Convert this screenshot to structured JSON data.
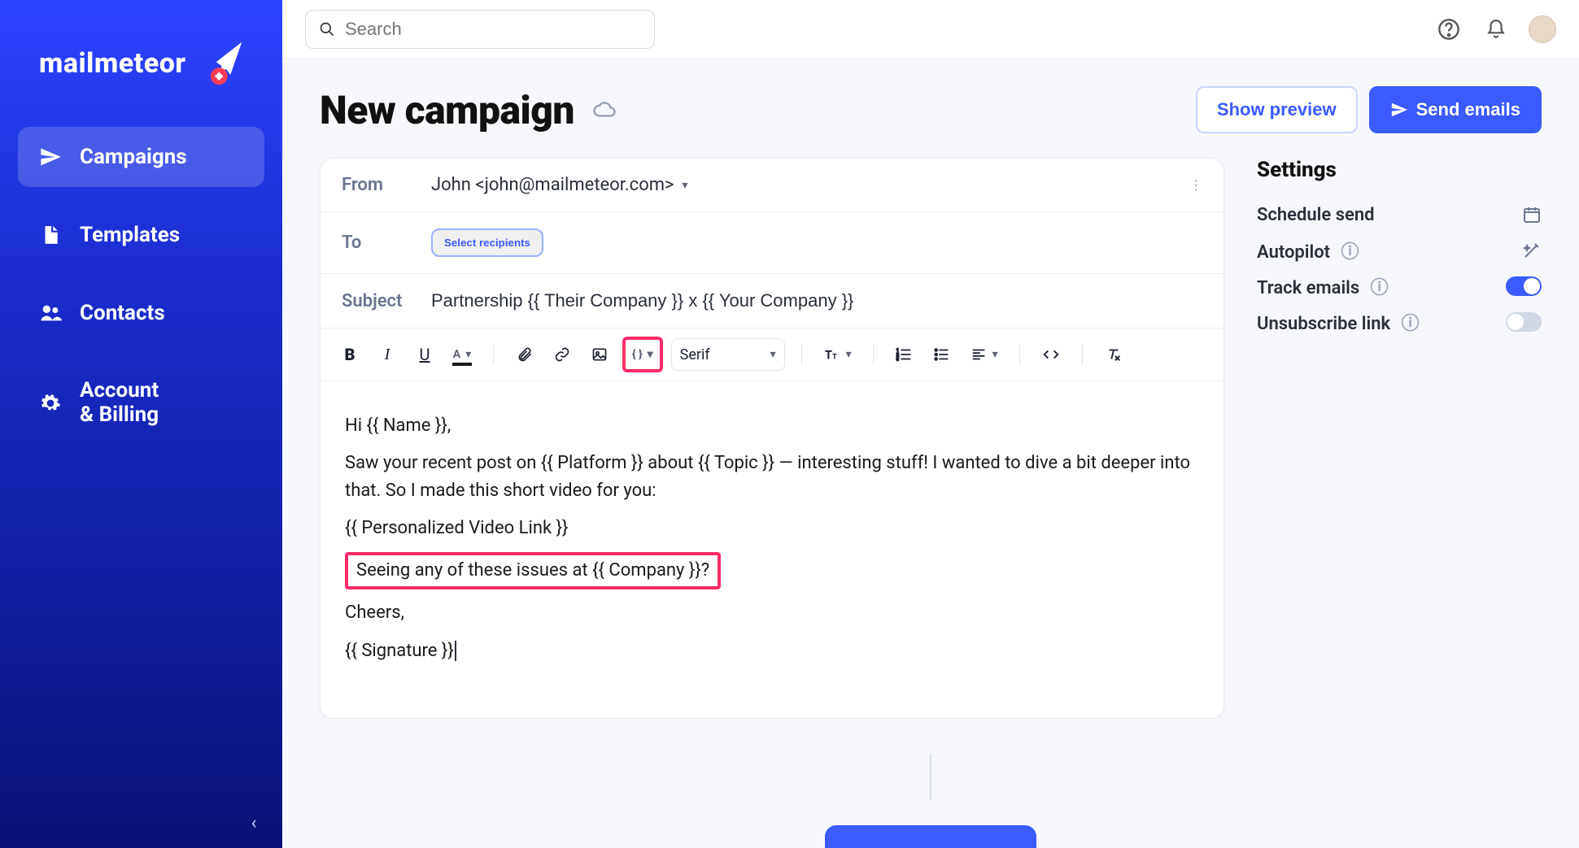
{
  "brand": {
    "name": "mailmeteor"
  },
  "nav": {
    "campaigns": "Campaigns",
    "templates": "Templates",
    "contacts": "Contacts",
    "account_line1": "Account",
    "account_line2": "& Billing"
  },
  "search": {
    "placeholder": "Search"
  },
  "page": {
    "title": "New campaign"
  },
  "actions": {
    "preview": "Show preview",
    "send": "Send emails"
  },
  "compose": {
    "from_label": "From",
    "from_value": "John <john@mailmeteor.com>",
    "to_label": "To",
    "select_recipients": "Select recipients",
    "subject_label": "Subject",
    "subject_value": "Partnership {{ Their Company }} x {{ Your Company }}",
    "font_family": "Serif",
    "body": {
      "p1": "Hi {{ Name }},",
      "p2": "Saw your recent post on {{ Platform }} about {{ Topic }} — interesting stuff! I wanted to dive a bit deeper into that. So I made this short video for you:",
      "p3": "{{ Personalized Video Link }}",
      "p4": "Seeing any of these issues at {{ Company }}?",
      "p5": "Cheers,",
      "p6": "{{ Signature }}"
    }
  },
  "settings": {
    "title": "Settings",
    "schedule": "Schedule send",
    "autopilot": "Autopilot",
    "track": "Track emails",
    "unsubscribe": "Unsubscribe link",
    "track_on": true,
    "unsubscribe_on": false
  },
  "glyphs": {
    "search": "🔍",
    "help": "?",
    "bell": "🔔",
    "more": "⋮",
    "caret": "▾",
    "chevron_left": "‹",
    "calendar": "📅",
    "wand": "✨",
    "info": "ⓘ"
  },
  "icons": {
    "bold": "B",
    "italic": "I",
    "underline": "U"
  }
}
